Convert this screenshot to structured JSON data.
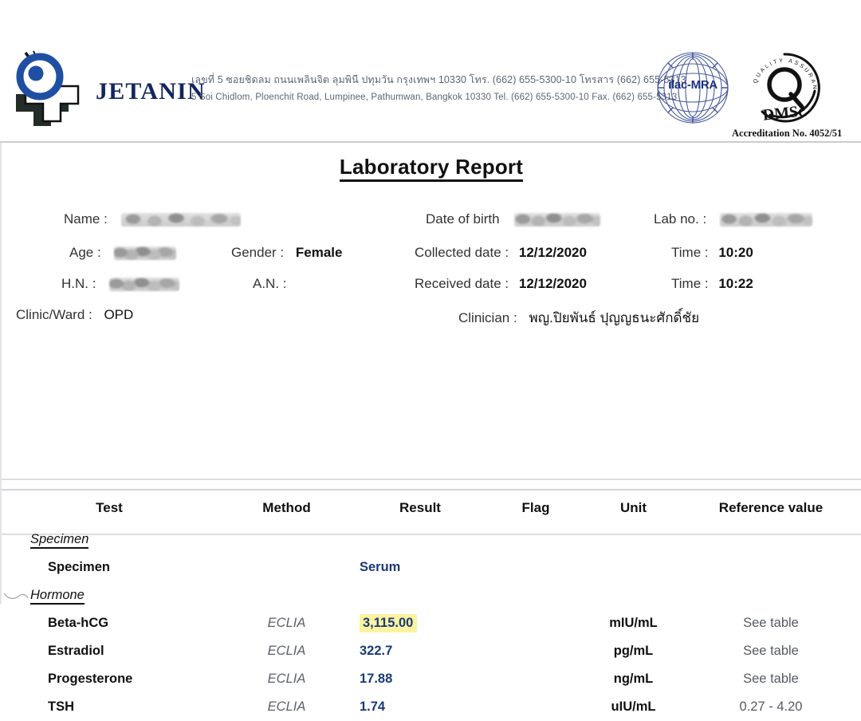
{
  "letterhead": {
    "brand_name": "JETANIN",
    "logo_icon": "jetanin-eye-cross-logo",
    "address_thai": "เลขที่ 5 ซอยชิดลม ถนนเพลินจิต ลุมพินี ปทุมวัน กรุงเทพฯ 10330 โทร. (662) 655-5300-10 โทรสาร (662) 655-5313",
    "address_english": "5 Soi Chidlom, Ploenchit Road, Lumpinee, Pathumwan, Bangkok 10330 Tel. (662) 655-5300-10 Fax. (662) 655-5313",
    "ilac_logo_text": "ilac-MRA",
    "dmsc_logo_letter": "Q",
    "dmsc_logo_name": "DMSc",
    "dmsc_logo_arc_text": "QUALITY ASSURANCE",
    "accreditation_no": "Accreditation No. 4052/51"
  },
  "report": {
    "title": "Laboratory Report"
  },
  "patient": {
    "name_label": "Name :",
    "name_value": "",
    "age_label": "Age :",
    "age_value": "",
    "gender_label": "Gender :",
    "gender_value": "Female",
    "hn_label": "H.N. :",
    "hn_value": "",
    "an_label": "A.N. :",
    "an_value": "",
    "clinic_ward_label": "Clinic/Ward :",
    "clinic_ward_value": "OPD",
    "dob_label": "Date of birth",
    "dob_value": "",
    "lab_no_label": "Lab no. :",
    "lab_no_value": "",
    "collected_date_label": "Collected date :",
    "collected_date_value": "12/12/2020",
    "collected_time_label": "Time :",
    "collected_time_value": "10:20",
    "received_date_label": "Received date :",
    "received_date_value": "12/12/2020",
    "received_time_label": "Time :",
    "received_time_value": "10:22",
    "clinician_label": "Clinician :",
    "clinician_value": "พญ.ปิยพันธ์ ปุญญธนะศักดิ์ชัย"
  },
  "table": {
    "headers": {
      "test": "Test",
      "method": "Method",
      "result": "Result",
      "flag": "Flag",
      "unit": "Unit",
      "reference": "Reference value"
    },
    "sections": [
      {
        "section_title": "Specimen",
        "rows": [
          {
            "test": "Specimen",
            "method": "",
            "result": "Serum",
            "flag": "",
            "unit": "",
            "reference": "",
            "highlight": false
          }
        ]
      },
      {
        "section_title": "Hormone",
        "rows": [
          {
            "test": "Beta-hCG",
            "method": "ECLIA",
            "result": "3,115.00",
            "flag": "",
            "unit": "mIU/mL",
            "reference": "See table",
            "highlight": true
          },
          {
            "test": "Estradiol",
            "method": "ECLIA",
            "result": "322.7",
            "flag": "",
            "unit": "pg/mL",
            "reference": "See table",
            "highlight": false
          },
          {
            "test": "Progesterone",
            "method": "ECLIA",
            "result": "17.88",
            "flag": "",
            "unit": "ng/mL",
            "reference": "See table",
            "highlight": false
          },
          {
            "test": "TSH",
            "method": "ECLIA",
            "result": "1.74",
            "flag": "",
            "unit": "uIU/mL",
            "reference": "0.27 - 4.20",
            "highlight": false
          }
        ]
      }
    ]
  },
  "colors": {
    "brand_navy": "#13265e",
    "result_blue": "#1a3a7a",
    "highlight_yellow": "#fbf39f",
    "ilac_blue": "#1d2f80",
    "address_gray": "#5c6670"
  }
}
